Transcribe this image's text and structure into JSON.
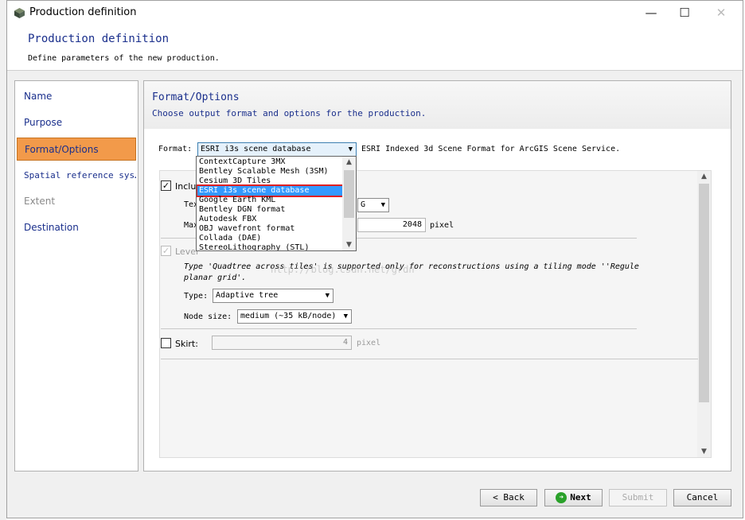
{
  "window": {
    "title": "Production definition",
    "minimize": "—",
    "maximize": "☐",
    "close": "✕"
  },
  "header": {
    "title": "Production definition",
    "subtitle": "Define parameters of the new production."
  },
  "sidebar": {
    "items": [
      {
        "label": "Name",
        "state": "normal"
      },
      {
        "label": "Purpose",
        "state": "normal"
      },
      {
        "label": "Format/Options",
        "state": "active"
      },
      {
        "label": "Spatial reference sys…",
        "state": "normal"
      },
      {
        "label": "Extent",
        "state": "disabled"
      },
      {
        "label": "Destination",
        "state": "normal"
      }
    ]
  },
  "section": {
    "title": "Format/Options",
    "subtitle": "Choose output format and options for the production."
  },
  "format": {
    "label": "Format:",
    "selected": "ESRI i3s scene database",
    "description": "ESRI Indexed 3d Scene Format for ArcGIS Scene Service.",
    "options": [
      "ContextCapture 3MX",
      "Bentley Scalable Mesh (3SM)",
      "Cesium 3D Tiles",
      "ESRI i3s scene database",
      "Google Earth KML",
      "Bentley DGN format",
      "Autodesk FBX",
      "OBJ wavefront format",
      "Collada (DAE)",
      "StereoLithography (STL)"
    ],
    "selected_index": 3
  },
  "options": {
    "include_label": "Inclu",
    "include_checked": true,
    "texture_label": "Tex",
    "texture_value": "G",
    "max_label": "Max",
    "max_value": "2048",
    "max_unit": "pixel",
    "lod_label": "Level",
    "lod_checked": true,
    "lod_note_1": "Type 'Quadtree across tiles' is supported only for reconstructions using a tiling mode ''Regule",
    "lod_note_2": "planar grid'.",
    "type_label": "Type:",
    "type_value": "Adaptive tree",
    "node_label": "Node size:",
    "node_value": "medium (~35 kB/node)",
    "skirt_label": "Skirt:",
    "skirt_checked": false,
    "skirt_value": "4",
    "skirt_unit": "pixel"
  },
  "watermark": "http://blog.csdn.net/grdn",
  "buttons": {
    "back": "< Back",
    "next": "Next",
    "submit": "Submit",
    "cancel": "Cancel"
  }
}
